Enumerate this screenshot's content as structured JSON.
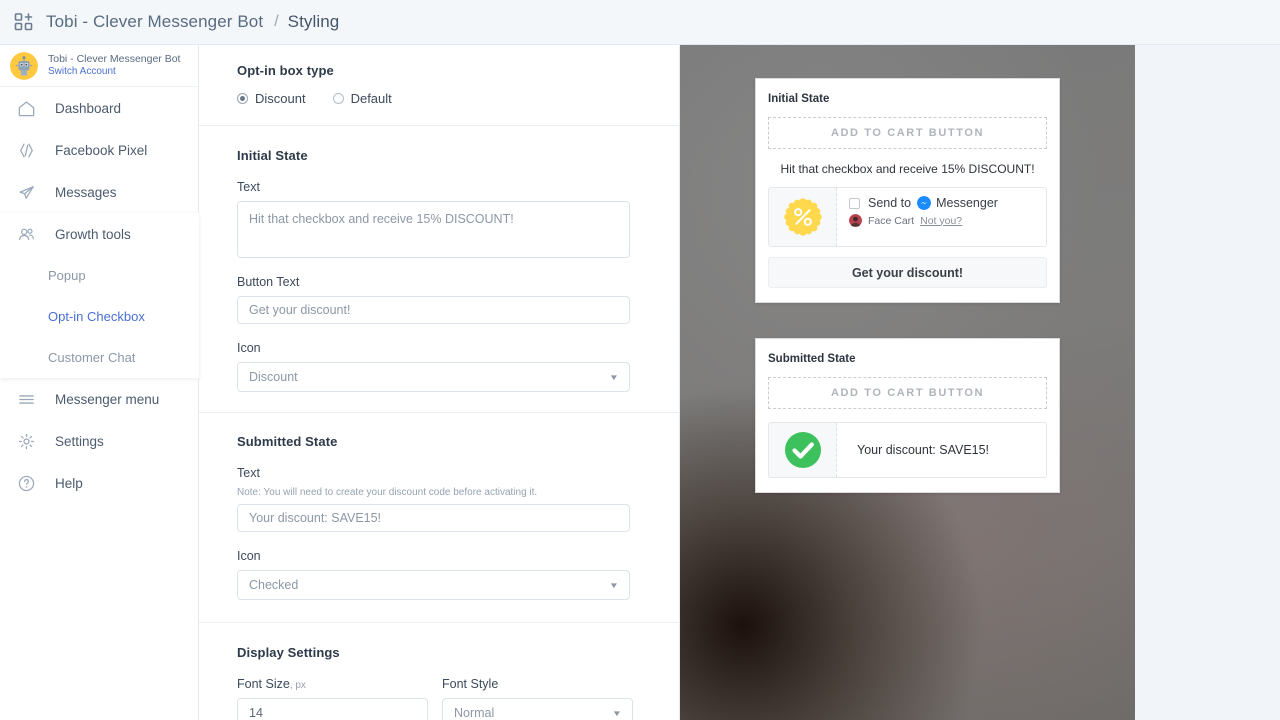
{
  "topbar": {
    "grid_icon": "grid-plus-icon",
    "title": "Tobi - Clever Messenger Bot",
    "separator": "/",
    "page": "Styling"
  },
  "sidebar": {
    "account": {
      "avatar_icon": "robot-avatar",
      "name": "Tobi - Clever Messenger Bot",
      "switch_label": "Switch Account"
    },
    "items": [
      {
        "label": "Dashboard",
        "icon": "home-icon"
      },
      {
        "label": "Facebook Pixel",
        "icon": "pixel-icon"
      },
      {
        "label": "Messages",
        "icon": "paper-plane-icon"
      },
      {
        "label": "Growth tools",
        "icon": "users-icon"
      }
    ],
    "growth_subitems": [
      {
        "label": "Popup",
        "active": false
      },
      {
        "label": "Opt-in Checkbox",
        "active": true
      },
      {
        "label": "Customer Chat",
        "active": false
      }
    ],
    "bottom_items": [
      {
        "label": "Messenger menu",
        "icon": "hamburger-icon"
      },
      {
        "label": "Settings",
        "icon": "gear-icon"
      },
      {
        "label": "Help",
        "icon": "question-circle-icon"
      }
    ]
  },
  "form": {
    "optin_box_type": {
      "title": "Opt-in box type",
      "options": [
        {
          "label": "Discount",
          "selected": true
        },
        {
          "label": "Default",
          "selected": false
        }
      ]
    },
    "initial_state": {
      "title": "Initial State",
      "text_label": "Text",
      "text_value": "Hit that checkbox and receive 15% DISCOUNT!",
      "button_text_label": "Button Text",
      "button_text_value": "Get your discount!",
      "icon_label": "Icon",
      "icon_value": "Discount"
    },
    "submitted_state": {
      "title": "Submitted State",
      "text_label": "Text",
      "note": "Note: You will need to create your discount code before activating it.",
      "text_value": "Your discount: SAVE15!",
      "icon_label": "Icon",
      "icon_value": "Checked"
    },
    "display_settings": {
      "title": "Display Settings",
      "font_size_label": "Font Size",
      "font_size_unit": ", px",
      "font_size_value": "14",
      "font_style_label": "Font Style",
      "font_style_value": "Normal"
    }
  },
  "preview": {
    "initial_card": {
      "title": "Initial State",
      "add_to_cart_label": "ADD TO CART BUTTON",
      "headline": "Hit that checkbox and receive 15% DISCOUNT!",
      "discount_icon": "percent-badge-icon",
      "send_to_label": "Send to",
      "messenger_icon": "messenger-icon",
      "messenger_label": "Messenger",
      "user_avatar_icon": "user-avatar",
      "user_name": "Face Cart",
      "not_you_label": "Not you?",
      "cta_label": "Get your discount!"
    },
    "submitted_card": {
      "title": "Submitted State",
      "add_to_cart_label": "ADD TO CART BUTTON",
      "check_icon": "green-check-icon",
      "discount_text": "Your discount: SAVE15!"
    }
  },
  "colors": {
    "accent_link": "#4a6fd4",
    "discount_yellow": "#ffd84d",
    "success_green": "#3dc15c",
    "messenger_blue": "#1a8cff",
    "page_bg": "#f1f5f9"
  }
}
